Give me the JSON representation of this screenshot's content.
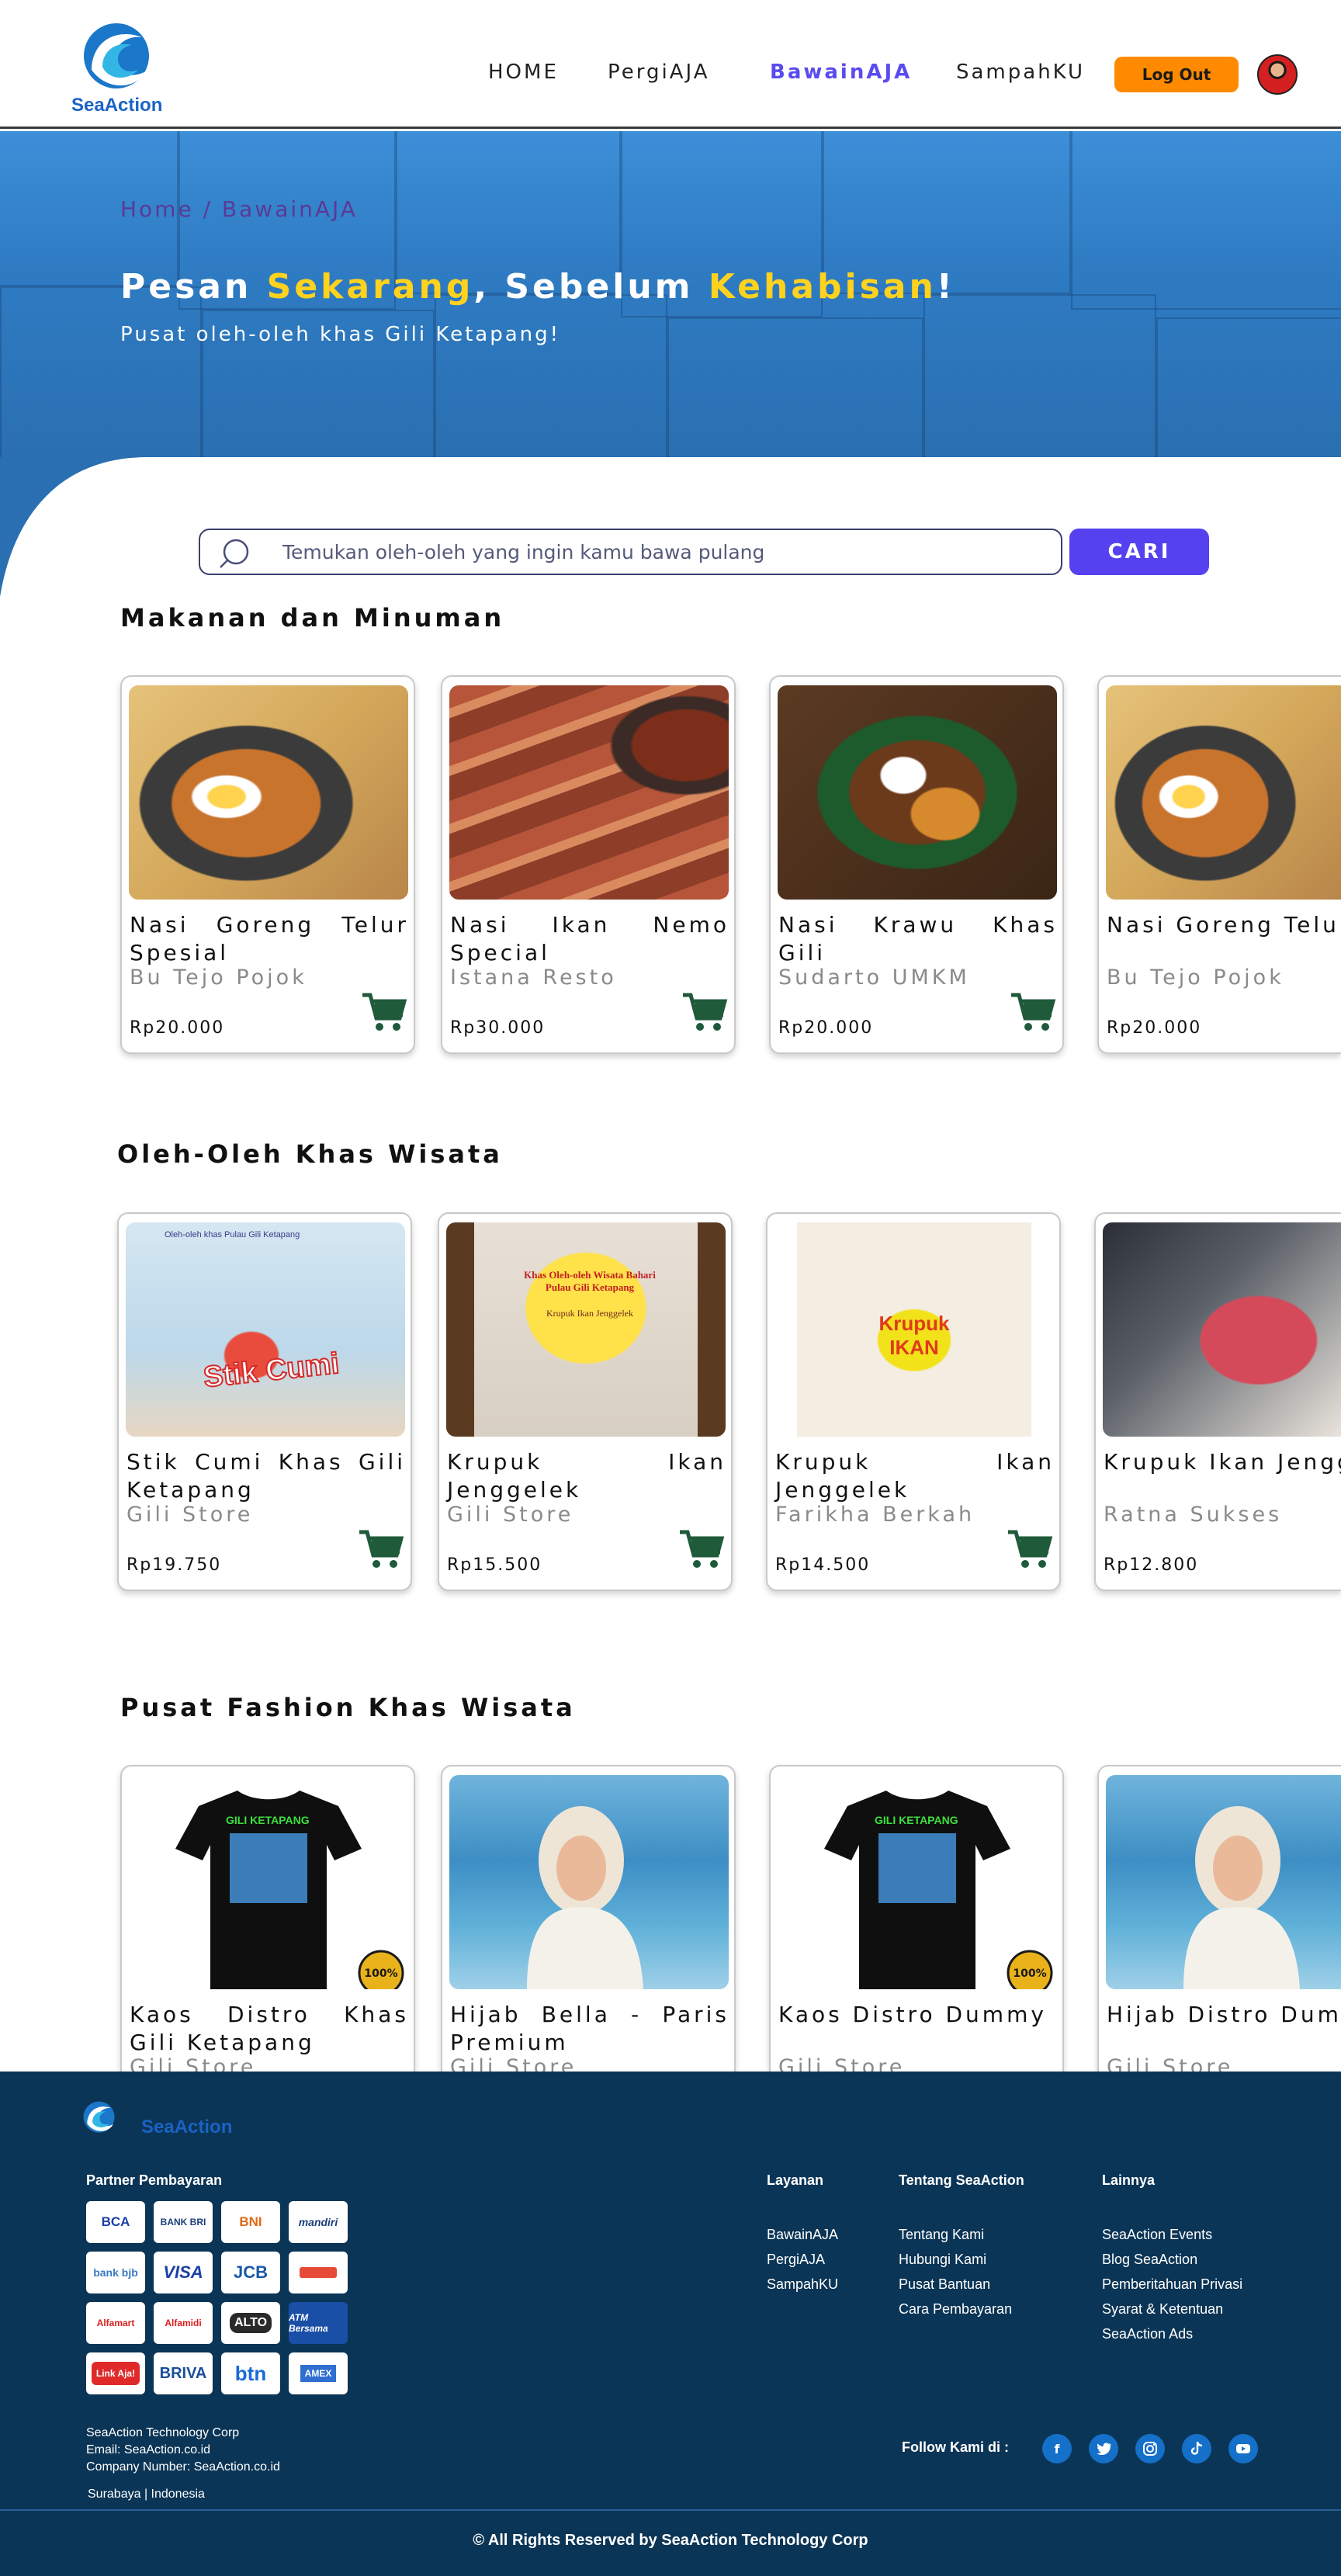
{
  "brand": {
    "name": "SeaAction"
  },
  "nav": {
    "items": [
      "HOME",
      "PergiAJA",
      "BawainAJA",
      "SampahKU"
    ],
    "active": "BawainAJA",
    "logout_label": "Log Out"
  },
  "hero": {
    "breadcrumb": "Home / BawainAJA",
    "title_part1": "Pesan ",
    "title_hl1": "Sekarang",
    "title_part2": ", Sebelum ",
    "title_hl2": "Kehabisan",
    "title_part3": "!",
    "subtitle": "Pusat oleh-oleh khas Gili Ketapang!"
  },
  "search": {
    "placeholder": "Temukan oleh-oleh yang ingin kamu bawa pulang",
    "button_label": "CARI"
  },
  "sections": [
    {
      "title": "Makanan dan Minuman",
      "products": [
        {
          "name": "Nasi Goreng Telur Spesial",
          "store": "Bu Tejo Pojok",
          "price": "Rp20.000"
        },
        {
          "name": "Nasi Ikan Nemo Special",
          "store": "Istana Resto",
          "price": "Rp30.000"
        },
        {
          "name": "Nasi Krawu Khas Gili",
          "store": "Sudarto UMKM",
          "price": "Rp20.000"
        },
        {
          "name": "Nasi Goreng Telur Spesial",
          "store": "Bu Tejo Pojok",
          "price": "Rp20.000"
        }
      ]
    },
    {
      "title": "Oleh-Oleh Khas Wisata",
      "products": [
        {
          "name": "Stik Cumi Khas Gili Ketapang",
          "store": "Gili Store",
          "price": "Rp19.750"
        },
        {
          "name": "Krupuk Ikan Jenggelek",
          "store": "Gili Store",
          "price": "Rp15.500"
        },
        {
          "name": "Krupuk Ikan Jenggelek",
          "store": "Farikha Berkah",
          "price": "Rp14.500"
        },
        {
          "name": "Krupuk Ikan Jenggelek",
          "store": "Ratna Sukses",
          "price": "Rp12.800"
        }
      ]
    },
    {
      "title": "Pusat Fashion Khas Wisata",
      "products": [
        {
          "name": "Kaos Distro Khas Gili Ketapang",
          "store": "Gili Store"
        },
        {
          "name": "Hijab Bella - Paris Premium",
          "store": "Gili Store"
        },
        {
          "name": "Kaos Distro Dummy",
          "store": "Gili Store"
        },
        {
          "name": "Hijab Distro Dummy",
          "store": "Gili Store"
        }
      ]
    }
  ],
  "image_text": {
    "cumi_brand": "Stik Cumi",
    "cumi_top": "Oleh-oleh khas Pulau Gili Ketapang",
    "krupuk1_title": "Khas Oleh-oleh Wisata Bahari Pulau Gili Ketapang",
    "krupuk1_sub": "Krupuk Ikan Jenggelek",
    "krupuk2_title": "Krupuk IKAN",
    "tshirt_text": "GILI KETAPANG"
  },
  "footer": {
    "partner_title": "Partner Pembayaran",
    "payments": [
      "BCA",
      "BANK BRI",
      "BNI",
      "mandiri",
      "bank bjb",
      "VISA",
      "JCB",
      "",
      "Alfamart",
      "Alfamidi",
      "ALTO",
      "ATM Bersama",
      "Link Aja!",
      "BRIVA",
      "btn",
      "AMEX"
    ],
    "company": "SeaAction Technology Corp",
    "email": "Email: SeaAction.co.id",
    "company_number": "Company Number: SeaAction.co.id",
    "location": "Surabaya | Indonesia",
    "columns": [
      {
        "title": "Layanan",
        "links": [
          "BawainAJA",
          "PergiAJA",
          "SampahKU"
        ]
      },
      {
        "title": "Tentang SeaAction",
        "links": [
          "Tentang Kami",
          "Hubungi Kami",
          "Pusat Bantuan",
          "Cara Pembayaran"
        ]
      },
      {
        "title": "Lainnya",
        "links": [
          "SeaAction Events",
          "Blog SeaAction",
          "Pemberitahuan Privasi",
          "Syarat & Ketentuan",
          "SeaAction Ads"
        ]
      }
    ],
    "follow_label": "Follow Kami di :",
    "socials": [
      "facebook-icon",
      "twitter-icon",
      "instagram-icon",
      "tiktok-icon",
      "youtube-icon"
    ],
    "copyright": "© All Rights Reserved by SeaAction Technology Corp"
  },
  "colors": {
    "accent": "#5641f0",
    "highlight": "#ffd21e",
    "logout": "#ff8a00",
    "footer_bg": "#0b3556",
    "cart": "#1f5a3a"
  }
}
